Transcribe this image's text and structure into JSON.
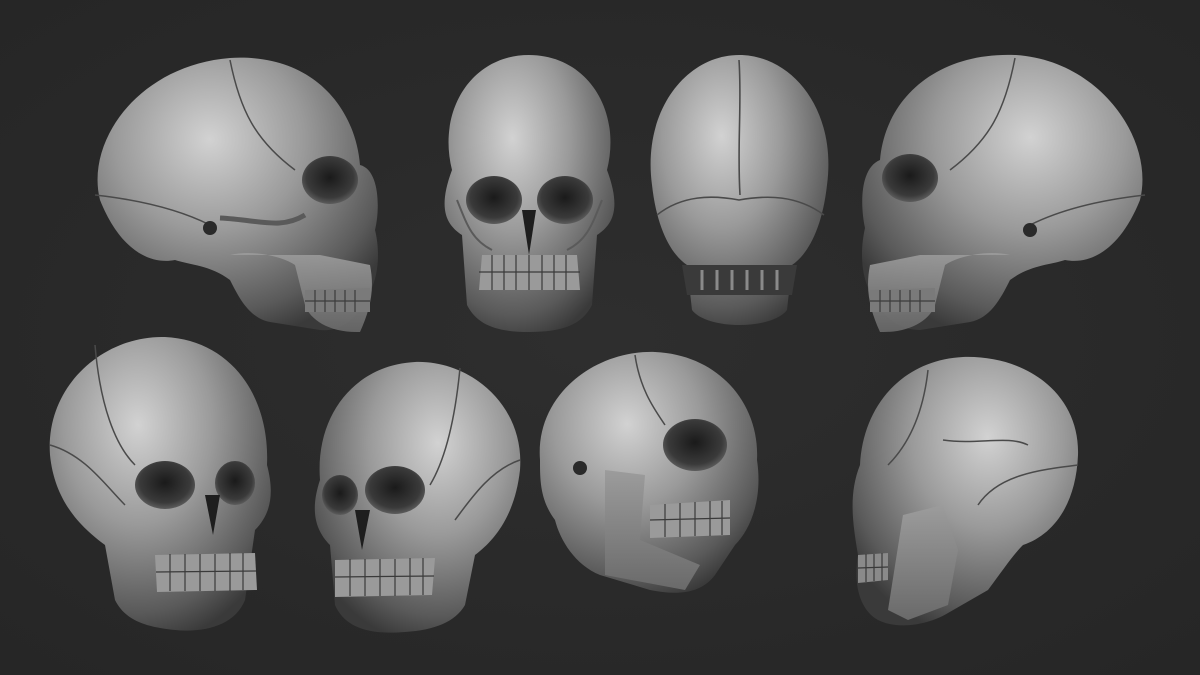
{
  "scene": {
    "background_color": "#282828",
    "bone_color": "#8e8e8e",
    "bone_highlight": "#c8c8c8",
    "bone_shadow": "#3c3c3c",
    "cavity_color": "#1e1e1e"
  },
  "skulls": [
    {
      "view": "left-profile"
    },
    {
      "view": "front"
    },
    {
      "view": "back"
    },
    {
      "view": "right-profile"
    },
    {
      "view": "front-three-quarter-right"
    },
    {
      "view": "front-three-quarter-left"
    },
    {
      "view": "low-three-quarter-left"
    },
    {
      "view": "rear-three-quarter-right"
    }
  ]
}
